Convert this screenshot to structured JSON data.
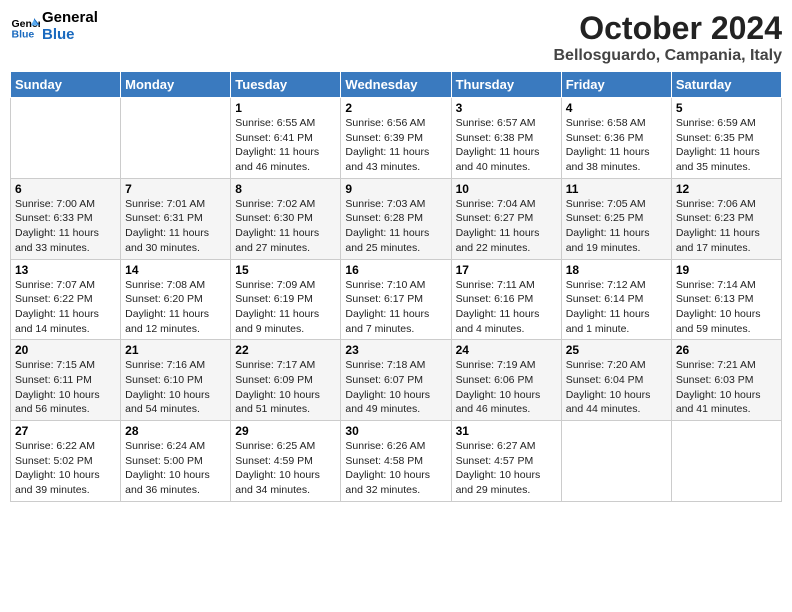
{
  "header": {
    "logo_general": "General",
    "logo_blue": "Blue",
    "month": "October 2024",
    "location": "Bellosguardo, Campania, Italy"
  },
  "days_of_week": [
    "Sunday",
    "Monday",
    "Tuesday",
    "Wednesday",
    "Thursday",
    "Friday",
    "Saturday"
  ],
  "weeks": [
    [
      {
        "day": null
      },
      {
        "day": null
      },
      {
        "day": "1",
        "sunrise": "Sunrise: 6:55 AM",
        "sunset": "Sunset: 6:41 PM",
        "daylight": "Daylight: 11 hours and 46 minutes."
      },
      {
        "day": "2",
        "sunrise": "Sunrise: 6:56 AM",
        "sunset": "Sunset: 6:39 PM",
        "daylight": "Daylight: 11 hours and 43 minutes."
      },
      {
        "day": "3",
        "sunrise": "Sunrise: 6:57 AM",
        "sunset": "Sunset: 6:38 PM",
        "daylight": "Daylight: 11 hours and 40 minutes."
      },
      {
        "day": "4",
        "sunrise": "Sunrise: 6:58 AM",
        "sunset": "Sunset: 6:36 PM",
        "daylight": "Daylight: 11 hours and 38 minutes."
      },
      {
        "day": "5",
        "sunrise": "Sunrise: 6:59 AM",
        "sunset": "Sunset: 6:35 PM",
        "daylight": "Daylight: 11 hours and 35 minutes."
      }
    ],
    [
      {
        "day": "6",
        "sunrise": "Sunrise: 7:00 AM",
        "sunset": "Sunset: 6:33 PM",
        "daylight": "Daylight: 11 hours and 33 minutes."
      },
      {
        "day": "7",
        "sunrise": "Sunrise: 7:01 AM",
        "sunset": "Sunset: 6:31 PM",
        "daylight": "Daylight: 11 hours and 30 minutes."
      },
      {
        "day": "8",
        "sunrise": "Sunrise: 7:02 AM",
        "sunset": "Sunset: 6:30 PM",
        "daylight": "Daylight: 11 hours and 27 minutes."
      },
      {
        "day": "9",
        "sunrise": "Sunrise: 7:03 AM",
        "sunset": "Sunset: 6:28 PM",
        "daylight": "Daylight: 11 hours and 25 minutes."
      },
      {
        "day": "10",
        "sunrise": "Sunrise: 7:04 AM",
        "sunset": "Sunset: 6:27 PM",
        "daylight": "Daylight: 11 hours and 22 minutes."
      },
      {
        "day": "11",
        "sunrise": "Sunrise: 7:05 AM",
        "sunset": "Sunset: 6:25 PM",
        "daylight": "Daylight: 11 hours and 19 minutes."
      },
      {
        "day": "12",
        "sunrise": "Sunrise: 7:06 AM",
        "sunset": "Sunset: 6:23 PM",
        "daylight": "Daylight: 11 hours and 17 minutes."
      }
    ],
    [
      {
        "day": "13",
        "sunrise": "Sunrise: 7:07 AM",
        "sunset": "Sunset: 6:22 PM",
        "daylight": "Daylight: 11 hours and 14 minutes."
      },
      {
        "day": "14",
        "sunrise": "Sunrise: 7:08 AM",
        "sunset": "Sunset: 6:20 PM",
        "daylight": "Daylight: 11 hours and 12 minutes."
      },
      {
        "day": "15",
        "sunrise": "Sunrise: 7:09 AM",
        "sunset": "Sunset: 6:19 PM",
        "daylight": "Daylight: 11 hours and 9 minutes."
      },
      {
        "day": "16",
        "sunrise": "Sunrise: 7:10 AM",
        "sunset": "Sunset: 6:17 PM",
        "daylight": "Daylight: 11 hours and 7 minutes."
      },
      {
        "day": "17",
        "sunrise": "Sunrise: 7:11 AM",
        "sunset": "Sunset: 6:16 PM",
        "daylight": "Daylight: 11 hours and 4 minutes."
      },
      {
        "day": "18",
        "sunrise": "Sunrise: 7:12 AM",
        "sunset": "Sunset: 6:14 PM",
        "daylight": "Daylight: 11 hours and 1 minute."
      },
      {
        "day": "19",
        "sunrise": "Sunrise: 7:14 AM",
        "sunset": "Sunset: 6:13 PM",
        "daylight": "Daylight: 10 hours and 59 minutes."
      }
    ],
    [
      {
        "day": "20",
        "sunrise": "Sunrise: 7:15 AM",
        "sunset": "Sunset: 6:11 PM",
        "daylight": "Daylight: 10 hours and 56 minutes."
      },
      {
        "day": "21",
        "sunrise": "Sunrise: 7:16 AM",
        "sunset": "Sunset: 6:10 PM",
        "daylight": "Daylight: 10 hours and 54 minutes."
      },
      {
        "day": "22",
        "sunrise": "Sunrise: 7:17 AM",
        "sunset": "Sunset: 6:09 PM",
        "daylight": "Daylight: 10 hours and 51 minutes."
      },
      {
        "day": "23",
        "sunrise": "Sunrise: 7:18 AM",
        "sunset": "Sunset: 6:07 PM",
        "daylight": "Daylight: 10 hours and 49 minutes."
      },
      {
        "day": "24",
        "sunrise": "Sunrise: 7:19 AM",
        "sunset": "Sunset: 6:06 PM",
        "daylight": "Daylight: 10 hours and 46 minutes."
      },
      {
        "day": "25",
        "sunrise": "Sunrise: 7:20 AM",
        "sunset": "Sunset: 6:04 PM",
        "daylight": "Daylight: 10 hours and 44 minutes."
      },
      {
        "day": "26",
        "sunrise": "Sunrise: 7:21 AM",
        "sunset": "Sunset: 6:03 PM",
        "daylight": "Daylight: 10 hours and 41 minutes."
      }
    ],
    [
      {
        "day": "27",
        "sunrise": "Sunrise: 6:22 AM",
        "sunset": "Sunset: 5:02 PM",
        "daylight": "Daylight: 10 hours and 39 minutes."
      },
      {
        "day": "28",
        "sunrise": "Sunrise: 6:24 AM",
        "sunset": "Sunset: 5:00 PM",
        "daylight": "Daylight: 10 hours and 36 minutes."
      },
      {
        "day": "29",
        "sunrise": "Sunrise: 6:25 AM",
        "sunset": "Sunset: 4:59 PM",
        "daylight": "Daylight: 10 hours and 34 minutes."
      },
      {
        "day": "30",
        "sunrise": "Sunrise: 6:26 AM",
        "sunset": "Sunset: 4:58 PM",
        "daylight": "Daylight: 10 hours and 32 minutes."
      },
      {
        "day": "31",
        "sunrise": "Sunrise: 6:27 AM",
        "sunset": "Sunset: 4:57 PM",
        "daylight": "Daylight: 10 hours and 29 minutes."
      },
      {
        "day": null
      },
      {
        "day": null
      }
    ]
  ]
}
